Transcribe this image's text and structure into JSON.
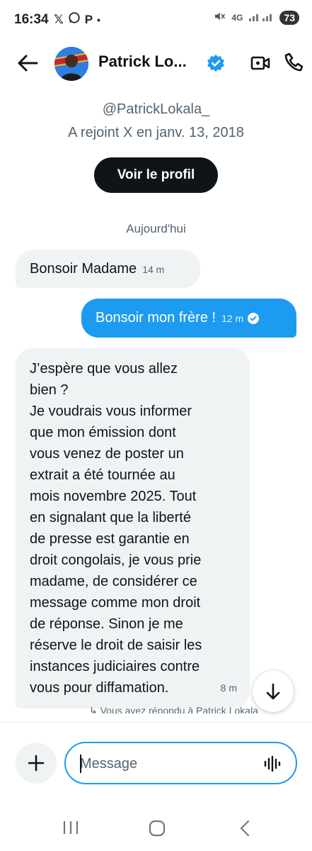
{
  "status_bar": {
    "time": "16:34",
    "left_icons": [
      "x-icon",
      "whatsapp-icon",
      "p-icon",
      "dot"
    ],
    "network": "4G",
    "battery": "73"
  },
  "header": {
    "name": "Patrick Lo...",
    "verified": true
  },
  "profile": {
    "handle": "@PatrickLokala_",
    "joined": "A rejoint X en janv. 13, 2018",
    "view_profile_label": "Voir le profil"
  },
  "date_separator": "Aujourd'hui",
  "messages": [
    {
      "direction": "in",
      "text": "Bonsoir Madame",
      "time": "14 m"
    },
    {
      "direction": "out",
      "text": "Bonsoir mon frère !",
      "time": "12 m",
      "read": true
    },
    {
      "direction": "in",
      "text": "J’espère que vous allez\nbien ?\nJe voudrais vous informer\nque mon émission dont\nvous venez de poster un\nextrait a été tournée au\nmois novembre 2025. Tout\nen signalant que la liberté\nde presse est garantie en\ndroit congolais, je vous prie\nmadame, de considérer ce\nmessage comme mon droit\nde réponse. Sinon je me\nréserve le droit de saisir les\ninstances judiciaires contre\nvous pour diffamation.",
      "time": "8 m"
    }
  ],
  "partial_text": "↳ Vous avez répondu à Patrick Lokala",
  "composer": {
    "placeholder": "Message"
  },
  "colors": {
    "accent": "#1d9bf0",
    "incoming_bubble": "#eff3f4",
    "text": "#0f1419",
    "secondary_text": "#536471"
  }
}
